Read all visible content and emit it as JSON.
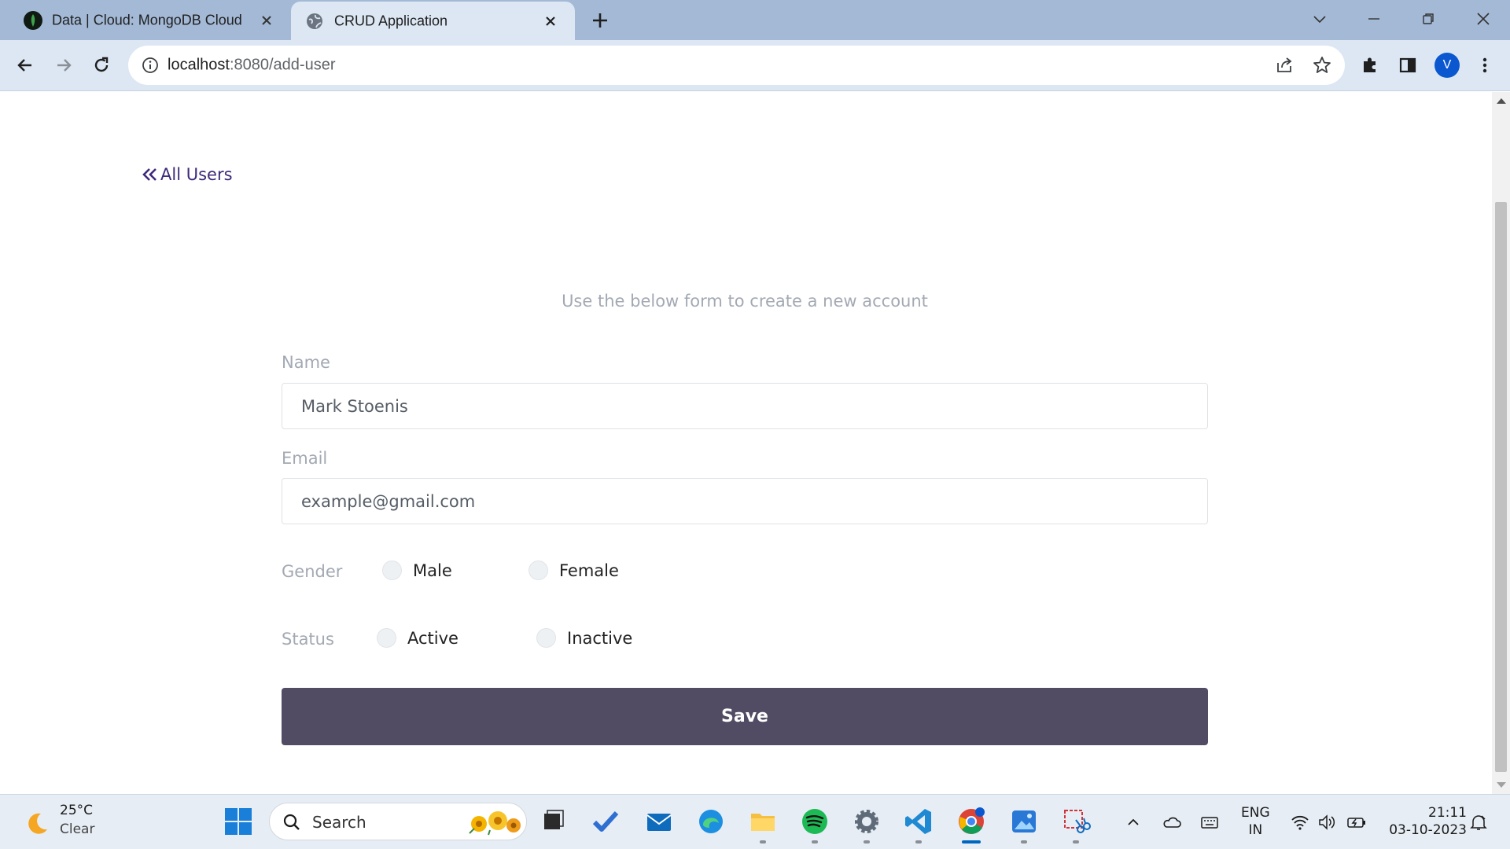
{
  "browser": {
    "tabs": [
      {
        "title": "Data | Cloud: MongoDB Cloud",
        "active": false,
        "favicon": "mongodb-leaf-icon"
      },
      {
        "title": "CRUD Application",
        "active": true,
        "favicon": "globe-icon"
      }
    ],
    "url_host": "localhost",
    "url_rest": ":8080/add-user",
    "profile_initial": "V"
  },
  "page": {
    "back_link": "All Users",
    "subtitle": "Use the below form to create a new account",
    "form": {
      "name_label": "Name",
      "name_value": "Mark Stoenis",
      "email_label": "Email",
      "email_placeholder": "example@gmail.com",
      "gender_label": "Gender",
      "gender_options": [
        "Male",
        "Female"
      ],
      "status_label": "Status",
      "status_options": [
        "Active",
        "Inactive"
      ],
      "save_label": "Save"
    },
    "colors": {
      "accent": "#514c63",
      "link": "#3f2a7c",
      "muted": "#a3a9b3"
    }
  },
  "taskbar": {
    "weather_temp": "25°C",
    "weather_condition": "Clear",
    "search_label": "Search",
    "language_top": "ENG",
    "language_bottom": "IN",
    "time": "21:11",
    "date": "03-10-2023"
  }
}
